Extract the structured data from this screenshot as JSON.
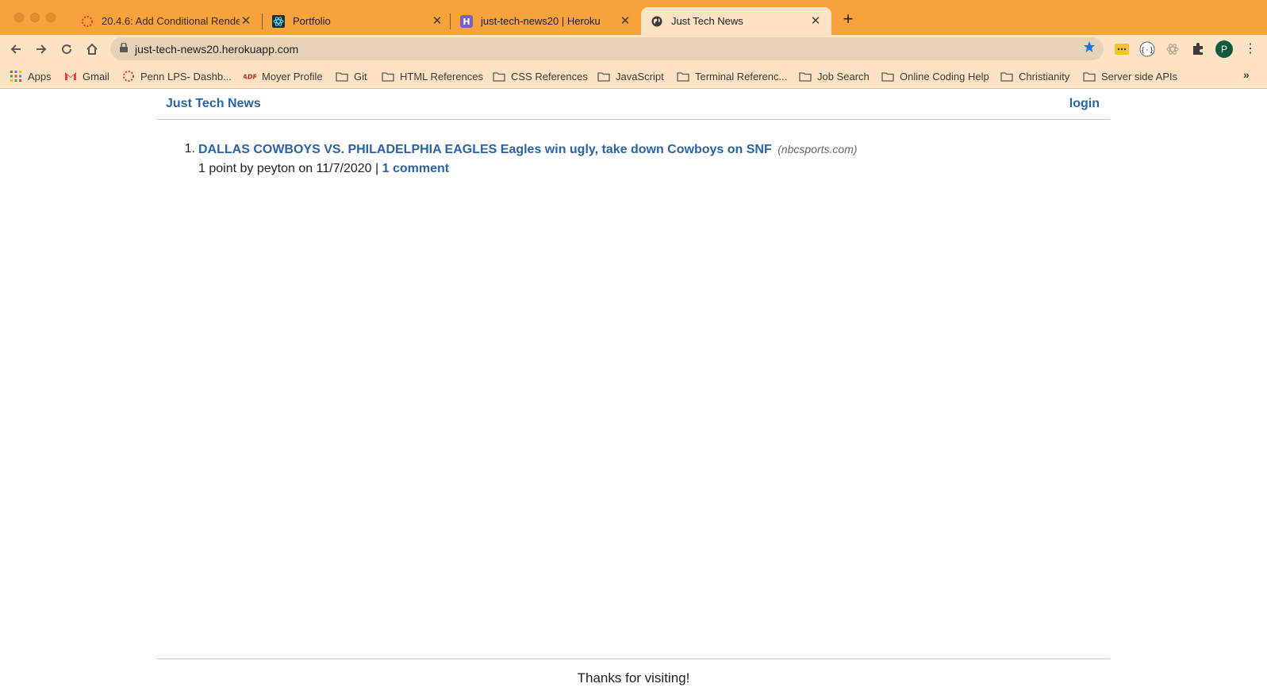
{
  "browser": {
    "tabs": [
      {
        "title": "20.4.6: Add Conditional Rende",
        "icon": "canvas-ring-icon",
        "active": false
      },
      {
        "title": "Portfolio",
        "icon": "react-atom-icon",
        "active": false
      },
      {
        "title": "just-tech-news20 | Heroku",
        "icon": "heroku-icon",
        "active": false
      },
      {
        "title": "Just Tech News",
        "icon": "globe-icon",
        "active": true
      }
    ],
    "url": "just-tech-news20.herokuapp.com",
    "profile_initial": "P",
    "bookmarks": [
      {
        "label": "Apps",
        "icon": "apps-grid-icon"
      },
      {
        "label": "Gmail",
        "icon": "gmail-icon"
      },
      {
        "label": "Penn LPS- Dashb...",
        "icon": "canvas-ring-icon"
      },
      {
        "label": "Moyer Profile",
        "icon": "adp-icon"
      },
      {
        "label": "Git",
        "icon": "folder-icon"
      },
      {
        "label": "HTML References",
        "icon": "folder-icon"
      },
      {
        "label": "CSS References",
        "icon": "folder-icon"
      },
      {
        "label": "JavaScript",
        "icon": "folder-icon"
      },
      {
        "label": "Terminal Referenc...",
        "icon": "folder-icon"
      },
      {
        "label": "Job Search",
        "icon": "folder-icon"
      },
      {
        "label": "Online Coding Help",
        "icon": "folder-icon"
      },
      {
        "label": "Christianity",
        "icon": "folder-icon"
      },
      {
        "label": "Server side APIs",
        "icon": "folder-icon"
      }
    ],
    "colors": {
      "tabbar": "#f8a23c",
      "toolbar": "#fde3c4",
      "link": "#2b63a8"
    }
  },
  "site": {
    "brand": "Just Tech News",
    "login_label": "login",
    "posts": [
      {
        "number": "1.",
        "title": "DALLAS COWBOYS VS. PHILADELPHIA EAGLES Eagles win ugly, take down Cowboys on SNF",
        "domain": "(nbcsports.com)",
        "meta": "1 point by peyton on 11/7/2020 |",
        "comments": "1 comment"
      }
    ],
    "footer": "Thanks for visiting!"
  }
}
